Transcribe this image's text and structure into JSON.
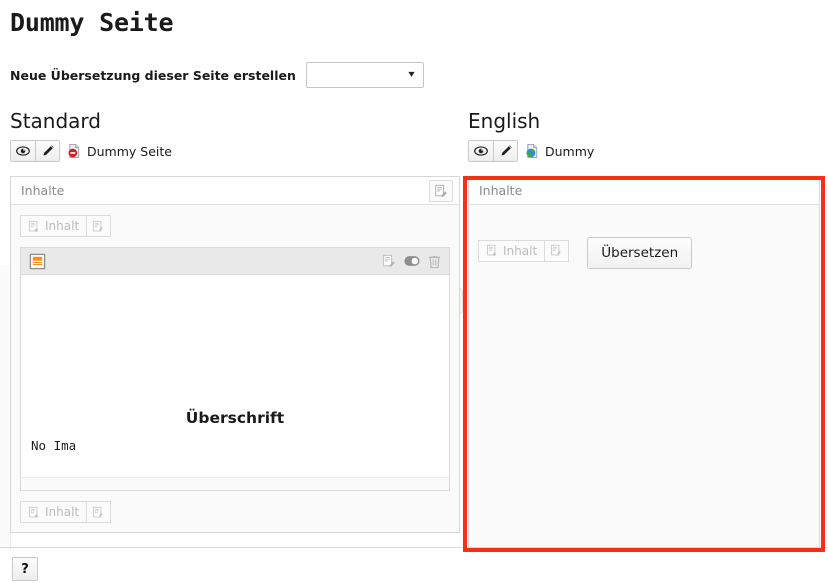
{
  "page": {
    "title": "Dummy Seite"
  },
  "translation_bar": {
    "label": "Neue Übersetzung dieser Seite erstellen",
    "select_value": "",
    "select_placeholder": "",
    "chevron": "chevron-down-icon"
  },
  "columns": [
    {
      "id": "standard",
      "heading": "Standard",
      "view_button_title": "Vorschau",
      "edit_button_title": "Bearbeiten",
      "record_label": "Dummy Seite",
      "record_icon": "page-hidden-icon",
      "panel": {
        "header_title": "Inhalte",
        "header_action_icon": "edit-contents-icon",
        "toolbar": {
          "new_content_label": "Inhalt",
          "new_content_icon": "document-plus-icon",
          "paste_icon": "document-paste-icon"
        },
        "content_element": {
          "type_icon": "text-with-header-icon",
          "actions": [
            "edit-record-icon",
            "toggle-visibility-icon",
            "delete-icon"
          ],
          "heading_text": "Überschrift",
          "body_text": "No Ima"
        },
        "toolbar_bottom": {
          "new_content_label": "Inhalt",
          "new_content_icon": "document-plus-icon",
          "paste_icon": "document-paste-icon"
        }
      }
    },
    {
      "id": "english",
      "heading": "English",
      "view_button_title": "Vorschau",
      "edit_button_title": "Bearbeiten",
      "record_label": "Dummy",
      "record_icon": "page-translated-icon",
      "panel": {
        "header_title": "Inhalte",
        "toolbar": {
          "new_content_label": "Inhalt",
          "new_content_icon": "document-plus-icon",
          "paste_icon": "document-paste-icon"
        },
        "translate_button_label": "Übersetzen"
      }
    }
  ],
  "footer": {
    "help_label": "?"
  },
  "colors": {
    "highlight": "#fc2d17",
    "content_type_accent": "#f3921e",
    "hidden_marker": "#d81d1d",
    "globe_blue": "#2a8fd4",
    "globe_green": "#4aa832",
    "panel_header_text": "#8a8a8a",
    "disabled_text": "#bdbdbd"
  }
}
